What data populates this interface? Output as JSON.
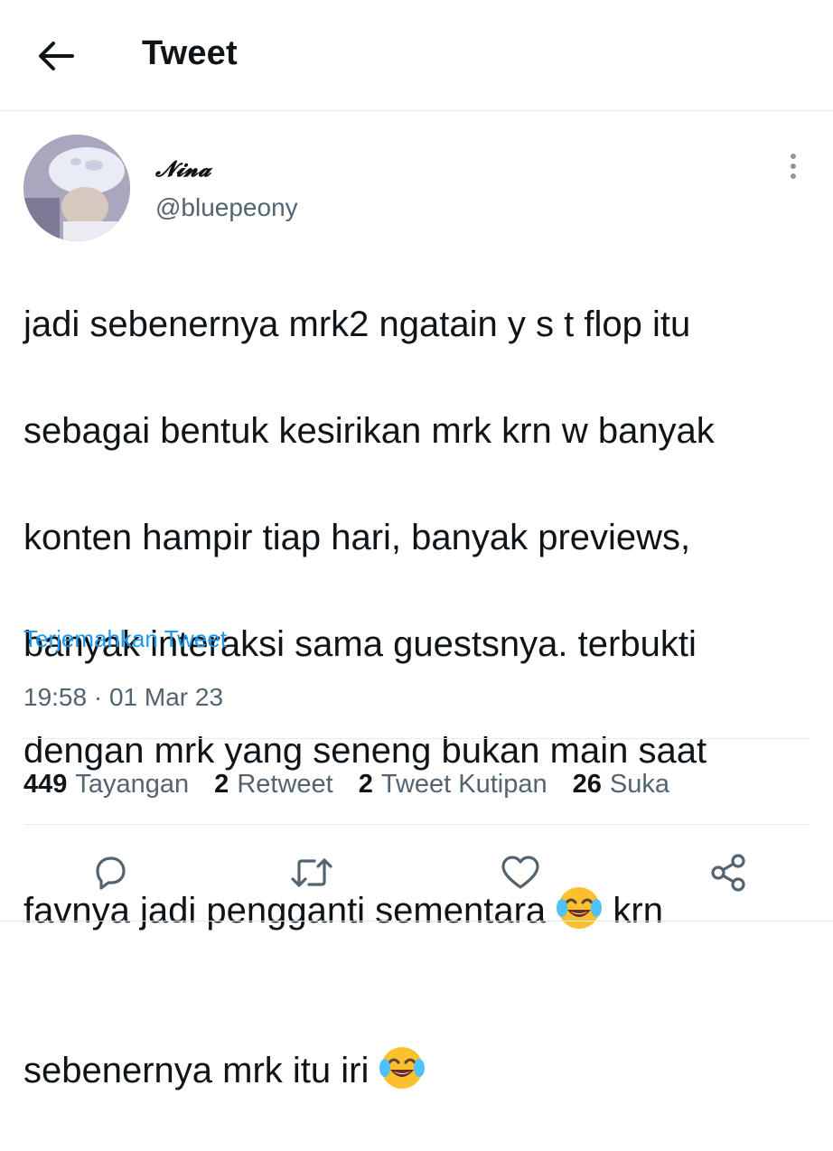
{
  "header": {
    "title": "Tweet"
  },
  "author": {
    "name": "𝓝𝓲𝓷𝓪",
    "handle": "@bluepeony"
  },
  "tweet": {
    "lines": [
      "jadi sebenernya mrk2 ngatain y s t flop itu",
      "sebagai bentuk kesirikan mrk krn w banyak",
      "konten hampir tiap hari, banyak previews,",
      "banyak interaksi sama guestsnya. terbukti",
      "dengan mrk yang seneng bukan main saat"
    ],
    "line6_before": "favnya jadi pengganti sementara ",
    "line6_after": " krn",
    "line7_before": "sebenernya mrk itu iri ",
    "emoji": "face-with-tears-of-joy"
  },
  "translate": "Terjemahkan Tweet",
  "timestamp": "19:58 · 01 Mar 23",
  "stats": {
    "views": {
      "count": "449",
      "label": "Tayangan"
    },
    "retweets": {
      "count": "2",
      "label": "Retweet"
    },
    "quotes": {
      "count": "2",
      "label": "Tweet Kutipan"
    },
    "likes": {
      "count": "26",
      "label": "Suka"
    }
  },
  "icons": {
    "back": "arrow-left-icon",
    "more": "more-vertical-icon",
    "reply": "reply-icon",
    "retweet": "retweet-icon",
    "like": "heart-icon",
    "share": "share-icon"
  },
  "colors": {
    "link": "#1d9bf0",
    "secondary_text": "#536471",
    "text": "#0f1419"
  }
}
